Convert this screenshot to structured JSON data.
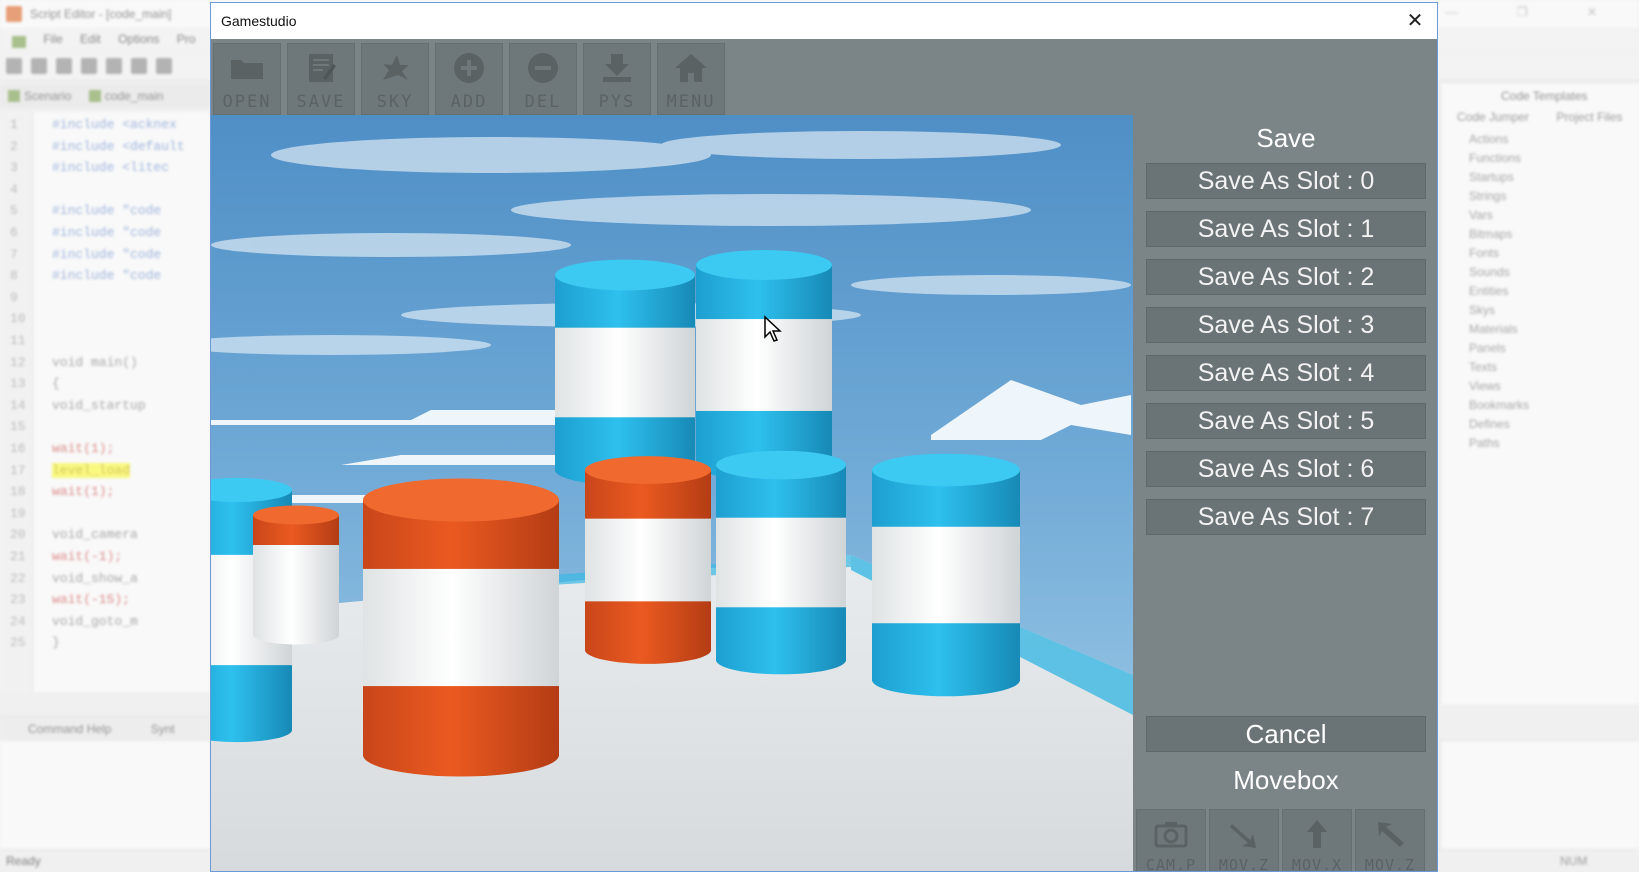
{
  "editor": {
    "title": "Script Editor - [code_main]",
    "menus": [
      "File",
      "Edit",
      "Options",
      "Pro"
    ],
    "tabs": [
      "Scenario",
      "code_main"
    ],
    "lines": [
      {
        "n": "1",
        "text": "#include <acknex",
        "kind": "dir"
      },
      {
        "n": "2",
        "text": "#include <default",
        "kind": "dir"
      },
      {
        "n": "3",
        "text": "#include <litec",
        "kind": "dir"
      },
      {
        "n": "4",
        "text": "",
        "kind": "code"
      },
      {
        "n": "5",
        "text": "#include \"code",
        "kind": "dir"
      },
      {
        "n": "6",
        "text": "#include \"code",
        "kind": "dir"
      },
      {
        "n": "7",
        "text": "#include \"code",
        "kind": "dir"
      },
      {
        "n": "8",
        "text": "#include \"code",
        "kind": "dir"
      },
      {
        "n": "9",
        "text": "",
        "kind": "code"
      },
      {
        "n": "10",
        "text": "",
        "kind": "code"
      },
      {
        "n": "11",
        "text": "",
        "kind": "code"
      },
      {
        "n": "12",
        "text": "void main()",
        "kind": "code"
      },
      {
        "n": "13",
        "text": "{",
        "kind": "code"
      },
      {
        "n": "14",
        "text": "   void_startup",
        "kind": "code"
      },
      {
        "n": "15",
        "text": "",
        "kind": "code"
      },
      {
        "n": "16",
        "text": "   wait(1);",
        "kind": "red"
      },
      {
        "n": "17",
        "text": "   level_load",
        "kind": "hl"
      },
      {
        "n": "18",
        "text": "   wait(1);",
        "kind": "red"
      },
      {
        "n": "19",
        "text": "",
        "kind": "code"
      },
      {
        "n": "20",
        "text": "   void_camera",
        "kind": "code"
      },
      {
        "n": "21",
        "text": "   wait(-1);",
        "kind": "red"
      },
      {
        "n": "22",
        "text": "   void_show_a",
        "kind": "code"
      },
      {
        "n": "23",
        "text": "   wait(-15);",
        "kind": "red"
      },
      {
        "n": "24",
        "text": "   void_goto_m",
        "kind": "code"
      },
      {
        "n": "25",
        "text": "}",
        "kind": "code"
      }
    ],
    "bottom_tabs": [
      "Command Help",
      "Synt"
    ],
    "right_header": "Code Templates",
    "right_tabs": [
      "Code Jumper",
      "Project Files"
    ],
    "templates": [
      "Actions",
      "Functions",
      "Startups",
      "Strings",
      "Vars",
      "Bitmaps",
      "Fonts",
      "Sounds",
      "Entities",
      "Skys",
      "Materials",
      "Panels",
      "Texts",
      "Views",
      "Bookmarks",
      "Defines",
      "Paths"
    ],
    "status": "Ready",
    "num_indicator": "NUM"
  },
  "gamestudio": {
    "title": "Gamestudio",
    "toolbar": [
      {
        "label": "OPEN",
        "icon": "folder-icon"
      },
      {
        "label": "SAVE",
        "icon": "save-icon"
      },
      {
        "label": "SKY",
        "icon": "sky-icon"
      },
      {
        "label": "ADD",
        "icon": "add-icon"
      },
      {
        "label": "DEL",
        "icon": "delete-icon"
      },
      {
        "label": "PYS",
        "icon": "physics-icon"
      },
      {
        "label": "MENU",
        "icon": "home-icon"
      }
    ],
    "panel": {
      "title": "Save",
      "slots": [
        "Save As Slot : 0",
        "Save As Slot : 1",
        "Save As Slot : 2",
        "Save As Slot : 3",
        "Save As Slot : 4",
        "Save As Slot : 5",
        "Save As Slot : 6",
        "Save As Slot : 7"
      ],
      "cancel": "Cancel",
      "movebox_title": "Movebox",
      "movebox_buttons": [
        {
          "label": "CAM.P",
          "icon": "camera-icon"
        },
        {
          "label": "MOV.Z",
          "icon": "arrow-down-right-icon"
        },
        {
          "label": "MOV.X",
          "icon": "arrow-up-icon"
        },
        {
          "label": "MOV.Z",
          "icon": "arrow-up-left-icon"
        }
      ]
    },
    "colors": {
      "panel_bg": "#7b8587",
      "button_bg": "#6a7375",
      "barrel_blue": "#20b4e6",
      "barrel_orange": "#e4541c",
      "barrel_white": "#f2f4f4"
    }
  }
}
